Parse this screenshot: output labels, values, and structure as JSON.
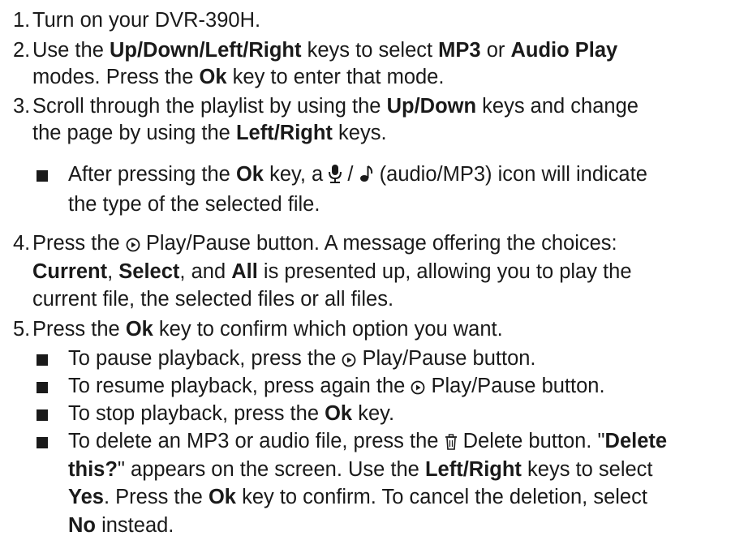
{
  "steps": {
    "s1": {
      "num": "1.",
      "a": "Turn on your DVR-390H."
    },
    "s2": {
      "num": "2.",
      "a": "Use the ",
      "b1": "Up/Down/Left/Right",
      "c": " keys to select ",
      "b2": "MP3",
      "d": " or ",
      "b3": "Audio Play",
      "l2a": "modes. Press the ",
      "l2b": "Ok",
      "l2c": " key to enter that mode."
    },
    "s3": {
      "num": "3.",
      "a": "Scroll through the playlist by using the ",
      "b1": "Up/Down",
      "c": " keys and change",
      "l2a": "the page by using the ",
      "l2b": "Left/Right",
      "l2c": " keys."
    },
    "s3_note": {
      "a": "After pressing the ",
      "b": "Ok",
      "c": " key, a ",
      "d": " (audio/MP3) icon will indicate",
      "l2": "the type of the selected file."
    },
    "s4": {
      "num": "4.",
      "a": "Press the ",
      "b": " Play/Pause button. A message offering the choices:",
      "l2b1": "Current",
      "l2a": ", ",
      "l2b2": "Select",
      "l2c": ", and ",
      "l2b3": "All",
      "l2d": " is presented up, allowing you to play the",
      "l3": "current file, the selected files or all files."
    },
    "s5": {
      "num": "5.",
      "a": "Press the ",
      "b": "Ok",
      "c": " key to confirm which option you want."
    },
    "s5_bullets": {
      "pause": {
        "a": "To pause playback, press the ",
        "b": " Play/Pause button."
      },
      "resume": {
        "a": "To resume playback, press again the ",
        "b": " Play/Pause button."
      },
      "stop": {
        "a": "To stop playback, press the ",
        "b": "Ok",
        "c": " key."
      },
      "delete": {
        "a": "To delete an MP3 or audio file, press the ",
        "b": " Delete button. \"",
        "b2": "Delete",
        "l2b": "this?",
        "l2a": "\" appears on the screen. Use the ",
        "l2b2": "Left/Right",
        "l2c": " keys to select",
        "l3b": "Yes",
        "l3a": ". Press the ",
        "l3b2": "Ok",
        "l3c": " key to confirm. To cancel the deletion, select",
        "l4b": "No",
        "l4a": " instead."
      }
    }
  },
  "icons": {
    "mic": "microphone-icon",
    "note": "music-note-icon",
    "play": "play-pause-icon",
    "trash": "trash-icon"
  }
}
